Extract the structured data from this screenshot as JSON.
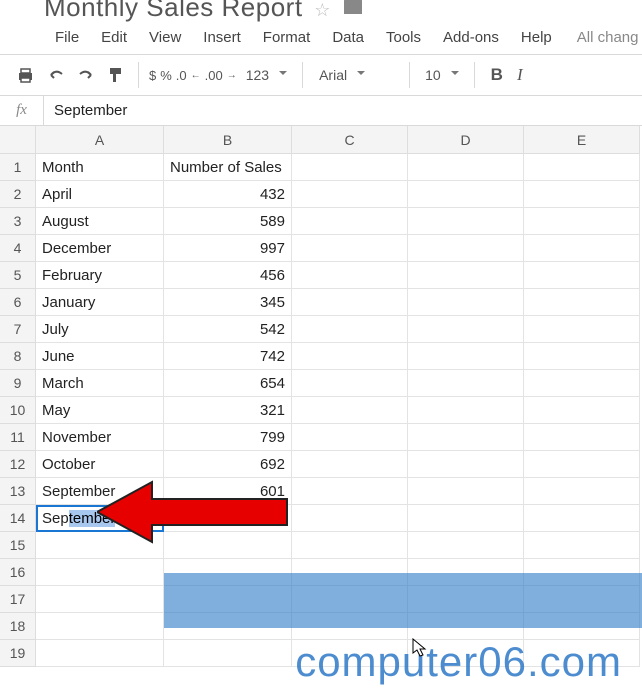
{
  "header": {
    "title": "Monthly Sales Report"
  },
  "menubar": [
    "File",
    "Edit",
    "View",
    "Insert",
    "Format",
    "Data",
    "Tools",
    "Add-ons",
    "Help"
  ],
  "menubar_extra": "All chang",
  "toolbar": {
    "currency": "$",
    "percent": "%",
    "dec_dec": ".0",
    "dec_inc": ".00",
    "more_formats": "123",
    "font": "Arial",
    "size": "10",
    "bold": "B",
    "italic": "I"
  },
  "fx": {
    "label": "fx",
    "value": "September"
  },
  "columns": [
    "A",
    "B",
    "C",
    "D",
    "E"
  ],
  "rows": [
    {
      "n": "1",
      "a": "Month",
      "b": "Number of Sales"
    },
    {
      "n": "2",
      "a": "April",
      "b": "432"
    },
    {
      "n": "3",
      "a": "August",
      "b": "589"
    },
    {
      "n": "4",
      "a": "December",
      "b": "997"
    },
    {
      "n": "5",
      "a": "February",
      "b": "456"
    },
    {
      "n": "6",
      "a": "January",
      "b": "345"
    },
    {
      "n": "7",
      "a": "July",
      "b": "542"
    },
    {
      "n": "8",
      "a": "June",
      "b": "742"
    },
    {
      "n": "9",
      "a": "March",
      "b": "654"
    },
    {
      "n": "10",
      "a": "May",
      "b": "321"
    },
    {
      "n": "11",
      "a": "November",
      "b": "799"
    },
    {
      "n": "12",
      "a": "October",
      "b": "692"
    },
    {
      "n": "13",
      "a": "September",
      "b": "601"
    }
  ],
  "editing_cell": {
    "row_label": "14",
    "prefix": "Sep",
    "selected": "tember"
  },
  "blank_rows": [
    "15",
    "16",
    "17",
    "18",
    "19"
  ],
  "watermark": "computer06.com"
}
